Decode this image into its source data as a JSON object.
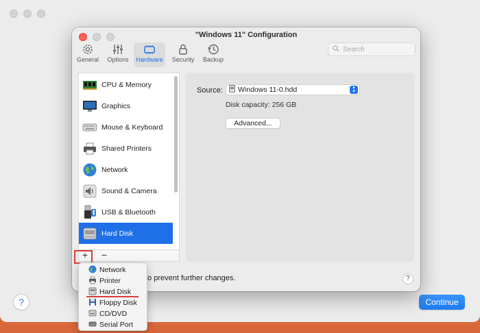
{
  "window": {
    "title": "\"Windows 11\" Configuration"
  },
  "toolbar": {
    "tabs": [
      {
        "label": "General",
        "icon": "gear-icon"
      },
      {
        "label": "Options",
        "icon": "sliders-icon"
      },
      {
        "label": "Hardware",
        "icon": "chip-icon",
        "active": true
      },
      {
        "label": "Security",
        "icon": "lock-icon"
      },
      {
        "label": "Backup",
        "icon": "clock-icon"
      }
    ],
    "search_placeholder": "Search"
  },
  "sidebar": {
    "items": [
      {
        "label": "CPU & Memory",
        "icon": "cpu-icon"
      },
      {
        "label": "Graphics",
        "icon": "monitor-icon"
      },
      {
        "label": "Mouse & Keyboard",
        "icon": "keyboard-icon"
      },
      {
        "label": "Shared Printers",
        "icon": "printer-icon"
      },
      {
        "label": "Network",
        "icon": "globe-icon"
      },
      {
        "label": "Sound & Camera",
        "icon": "speaker-icon"
      },
      {
        "label": "USB & Bluetooth",
        "icon": "usb-icon"
      },
      {
        "label": "Hard Disk",
        "icon": "hard-disk-icon",
        "selected": true
      }
    ],
    "add_label": "+",
    "remove_label": "−"
  },
  "detail": {
    "source_label": "Source:",
    "source_value": "Windows 11-0.hdd",
    "disk_capacity": "Disk capacity: 256 GB",
    "advanced_label": "Advanced..."
  },
  "footer": {
    "lock_text": "to prevent further changes.",
    "help_label": "?",
    "continue_label": "Continue",
    "outer_help_label": "?"
  },
  "add_menu": {
    "items": [
      {
        "label": "Network",
        "icon": "globe-icon"
      },
      {
        "label": "Printer",
        "icon": "printer-icon"
      },
      {
        "label": "Hard Disk",
        "icon": "hard-disk-icon",
        "highlighted": true
      },
      {
        "label": "Floppy Disk",
        "icon": "floppy-icon"
      },
      {
        "label": "CD/DVD",
        "icon": "cd-icon"
      },
      {
        "label": "Serial Port",
        "icon": "serial-port-icon"
      }
    ]
  },
  "colors": {
    "accent": "#1e6fe8",
    "highlight_red": "#d93b3b"
  }
}
